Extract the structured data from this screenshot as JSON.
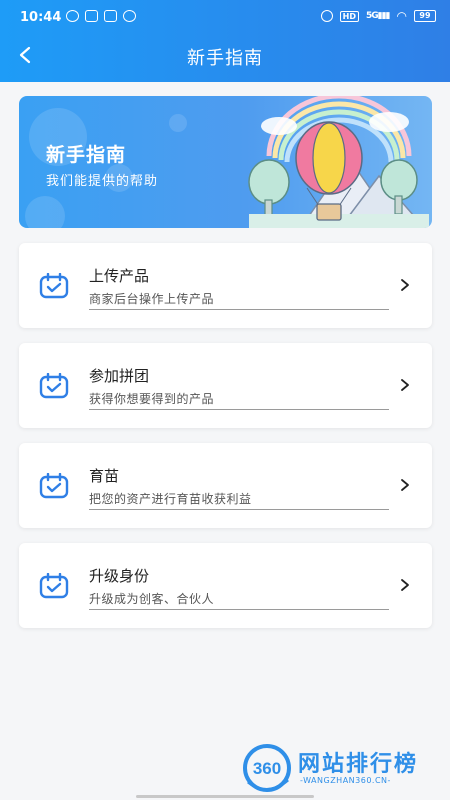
{
  "status_bar": {
    "time": "10:44",
    "hd": "HD",
    "signal": "5G",
    "battery": "99"
  },
  "nav": {
    "title": "新手指南",
    "back_icon": "chevron-left-icon"
  },
  "banner": {
    "title": "新手指南",
    "subtitle": "我们能提供的帮助",
    "illustration": "hot-air-balloon"
  },
  "items": [
    {
      "title": "上传产品",
      "desc": "商家后台操作上传产品",
      "icon": "calendar-check-icon"
    },
    {
      "title": "参加拼团",
      "desc": "获得你想要得到的产品",
      "icon": "calendar-check-icon"
    },
    {
      "title": "育苗",
      "desc": "把您的资产进行育苗收获利益",
      "icon": "calendar-check-icon"
    },
    {
      "title": "升级身份",
      "desc": "升级成为创客、合伙人",
      "icon": "calendar-check-icon"
    }
  ],
  "watermark": {
    "logo_text": "360",
    "name": "网站排行榜",
    "url": "WANGZHAN360.CN"
  },
  "colors": {
    "header_start": "#1e9cf7",
    "header_end": "#2f7fe6",
    "icon_blue": "#2f7fe6",
    "watermark_blue": "#2f8fe8"
  }
}
